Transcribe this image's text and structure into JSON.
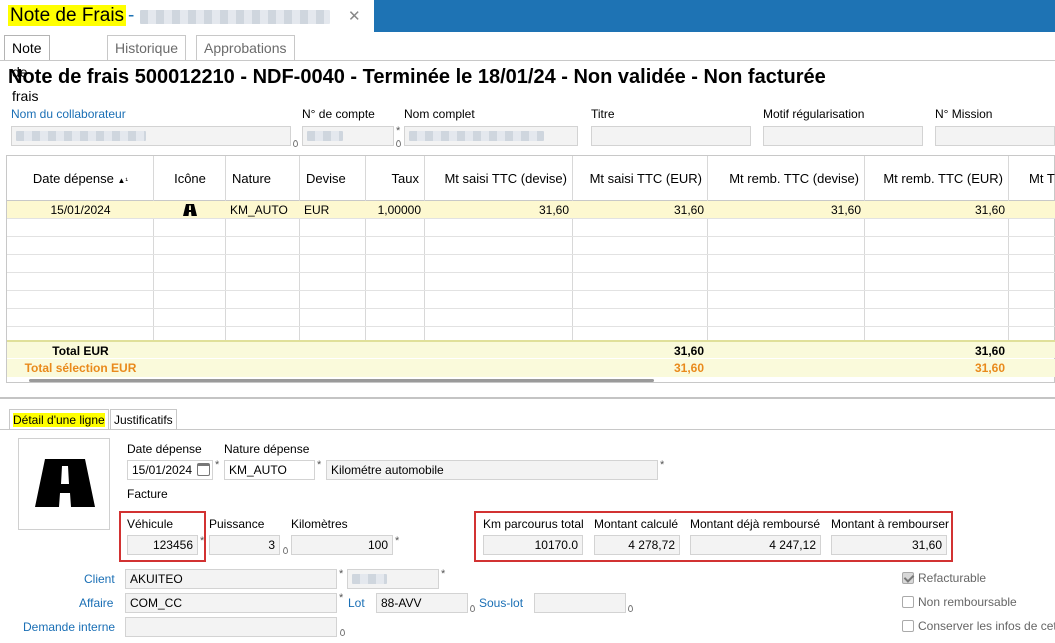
{
  "window": {
    "app_name": "Note de Frais",
    "dash": "-",
    "close_glyph": "✕"
  },
  "tabs": [
    "Note de frais",
    "Historique",
    "Approbations"
  ],
  "page_title": "Note de frais 500012210 - NDF-0040 - Terminée le 18/01/24 - Non validée - Non facturée",
  "header": {
    "collaborateur_label": "Nom du collaborateur",
    "compte_label": "N° de compte",
    "nom_complet_label": "Nom complet",
    "titre_label": "Titre",
    "motif_label": "Motif régularisation",
    "mission_label": "N° Mission",
    "required_mark": "*"
  },
  "grid": {
    "columns": [
      "Date dépense",
      "Icône",
      "Nature",
      "Devise",
      "Taux",
      "Mt saisi TTC (devise)",
      "Mt saisi TTC (EUR)",
      "Mt remb. TTC (devise)",
      "Mt remb. TTC (EUR)",
      "Mt T"
    ],
    "sort_indicator": "▲¹",
    "rows": [
      {
        "date": "15/01/2024",
        "nature": "KM_AUTO",
        "devise": "EUR",
        "taux": "1,00000",
        "mt_saisi_devise": "31,60",
        "mt_saisi_eur": "31,60",
        "mt_remb_devise": "31,60",
        "mt_remb_eur": "31,60"
      }
    ],
    "total_label": "Total EUR",
    "total_saisi_eur": "31,60",
    "total_remb_eur": "31,60",
    "total_sel_label": "Total sélection EUR",
    "total_sel_saisi_eur": "31,60",
    "total_sel_remb_eur": "31,60"
  },
  "detail_tabs": [
    "Détail d'une ligne",
    "Justificatifs"
  ],
  "detail": {
    "date_label": "Date dépense",
    "date_value": "15/01/2024",
    "nature_label": "Nature dépense",
    "nature_code": "KM_AUTO",
    "nature_desc": "Kilométre automobile",
    "facture_label": "Facture",
    "vehicule_label": "Véhicule",
    "vehicule_value": "123456",
    "puissance_label": "Puissance",
    "puissance_value": "3",
    "km_label": "Kilomètres",
    "km_value": "100",
    "km_total_label": "Km parcourus total",
    "km_total_value": "10170.0",
    "montant_calc_label": "Montant calculé",
    "montant_calc_value": "4 278,72",
    "montant_deja_label": "Montant déjà remboursé",
    "montant_deja_value": "4 247,12",
    "montant_a_label": "Montant à rembourser",
    "montant_a_value": "31,60",
    "client_label": "Client",
    "client_value": "AKUITEO",
    "affaire_label": "Affaire",
    "affaire_value": "COM_CC",
    "lot_label": "Lot",
    "lot_value": "88-AVV",
    "souslot_label": "Sous-lot",
    "demande_label": "Demande interne",
    "refacturable_label": "Refacturable",
    "non_remb_label": "Non remboursable",
    "conserver_label": "Conserver les infos de cett"
  },
  "colors": {
    "accent": "#1e73b4",
    "highlight": "#ffff00",
    "selection_row": "#fdf8d0",
    "total_orange": "#e98a1c",
    "annotation_red": "#d23232"
  }
}
